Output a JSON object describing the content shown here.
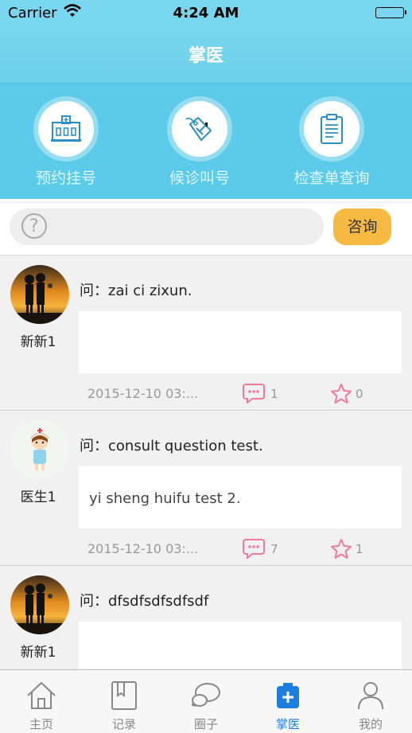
{
  "status_bar": {
    "carrier": "Carrier",
    "time": "4:24 AM"
  },
  "header": {
    "title": "掌医"
  },
  "quick_actions": [
    {
      "label": "预约挂号",
      "icon": "hospital-building-icon"
    },
    {
      "label": "候诊叫号",
      "icon": "medical-tag-icon"
    },
    {
      "label": "检查单查询",
      "icon": "clipboard-icon"
    }
  ],
  "search": {
    "placeholder_icon": "question-icon",
    "button_label": "咨询"
  },
  "posts": [
    {
      "user": "新新1",
      "avatar": "sunset-couple-avatar",
      "question": "问：zai ci zixun.",
      "answer": "",
      "date": "2015-12-10 03:...",
      "comments": "1",
      "favorites": "0"
    },
    {
      "user": "医生1",
      "avatar": "nurse-avatar",
      "question": "问：consult question test.",
      "answer": "yi sheng huifu test 2.",
      "date": "2015-12-10 03:...",
      "comments": "7",
      "favorites": "1"
    },
    {
      "user": "新新1",
      "avatar": "sunset-couple-avatar",
      "question": "问：dfsdfsdfsdfsdf",
      "answer": "",
      "date": "",
      "comments": "",
      "favorites": ""
    }
  ],
  "tabs": [
    {
      "label": "主页",
      "icon": "home-icon",
      "active": false
    },
    {
      "label": "记录",
      "icon": "book-icon",
      "active": false
    },
    {
      "label": "圈子",
      "icon": "chat-bubbles-icon",
      "active": false
    },
    {
      "label": "掌医",
      "icon": "medical-kit-icon",
      "active": true
    },
    {
      "label": "我的",
      "icon": "person-icon",
      "active": false
    }
  ],
  "colors": {
    "header": "#78d6ee",
    "quick_bg": "#5ccbe9",
    "accent_button": "#f6b942",
    "active_tab": "#1c7fe0",
    "icon_pink": "#f07a9a"
  }
}
